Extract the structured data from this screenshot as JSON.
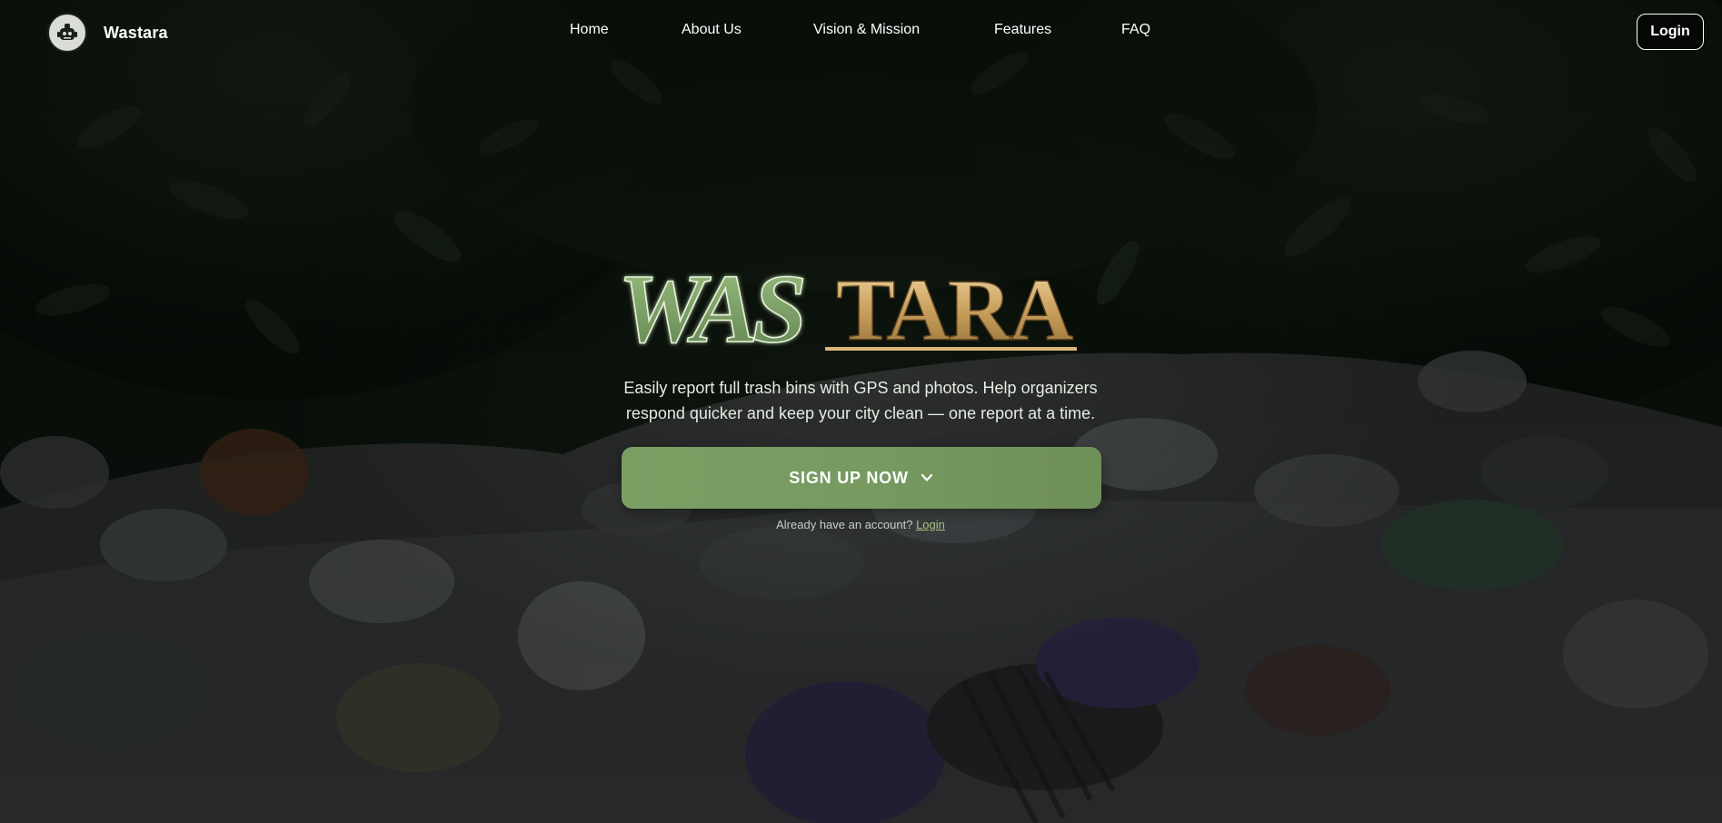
{
  "brand": {
    "name": "Wastara",
    "logo_icon": "robot-mascot-icon"
  },
  "nav": {
    "items": [
      {
        "label": "Home"
      },
      {
        "label": "About Us"
      },
      {
        "label": "Vision & Mission"
      },
      {
        "label": "Features"
      },
      {
        "label": "FAQ"
      }
    ],
    "login_label": "Login"
  },
  "hero": {
    "wordmark_part1": "WAS",
    "wordmark_part2": "TARA",
    "tagline_line1": "Easily report full trash bins with GPS and photos. Help organizers",
    "tagline_line2": "respond quicker and keep your city clean — one report at a time.",
    "signup_label": "SIGN UP NOW",
    "signup_icon": "chevron-down-icon",
    "account_prompt": "Already have an account?",
    "account_login": "Login"
  },
  "colors": {
    "accent_green": "#779b61",
    "wordmark_green": "#7fa06a",
    "wordmark_gold": "#d8b67a",
    "link_green": "#a6c284",
    "nav_text": "#ffffff"
  },
  "background_image": "dark foliage above a pile of trash bags"
}
